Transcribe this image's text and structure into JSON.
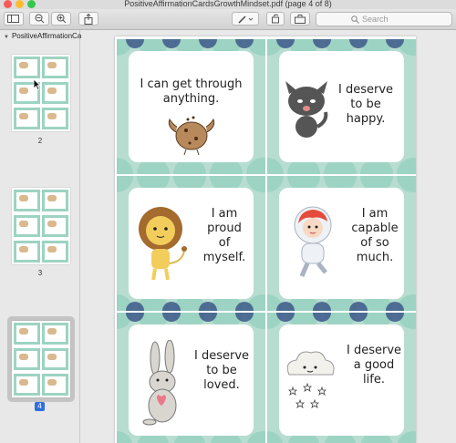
{
  "window": {
    "title": "PositiveAffirmationCardsGrowthMindset.pdf (page 4 of 8)",
    "search_placeholder": "Search"
  },
  "sidebar": {
    "document_name": "PositiveAffirmationCa...",
    "pages": [
      {
        "label": "2"
      },
      {
        "label": "3"
      },
      {
        "label": "4",
        "selected": true
      }
    ]
  },
  "cards": [
    {
      "text": "I can get through\nanything.",
      "illustration": "cookie-icon"
    },
    {
      "text": "I deserve\nto be\nhappy.",
      "illustration": "cat-icon"
    },
    {
      "text": "I am\nproud\nof\nmyself.",
      "illustration": "lion-icon"
    },
    {
      "text": "I am\ncapable\nof so\nmuch.",
      "illustration": "astronaut-icon"
    },
    {
      "text": "I deserve\nto be\nloved.",
      "illustration": "bunny-icon"
    },
    {
      "text": "I deserve\na good\nlife.",
      "illustration": "cloud-icon"
    }
  ],
  "colors": {
    "mint": "#9dd3c2",
    "navy": "#3d5a8a",
    "sage": "#b7ddd0"
  }
}
